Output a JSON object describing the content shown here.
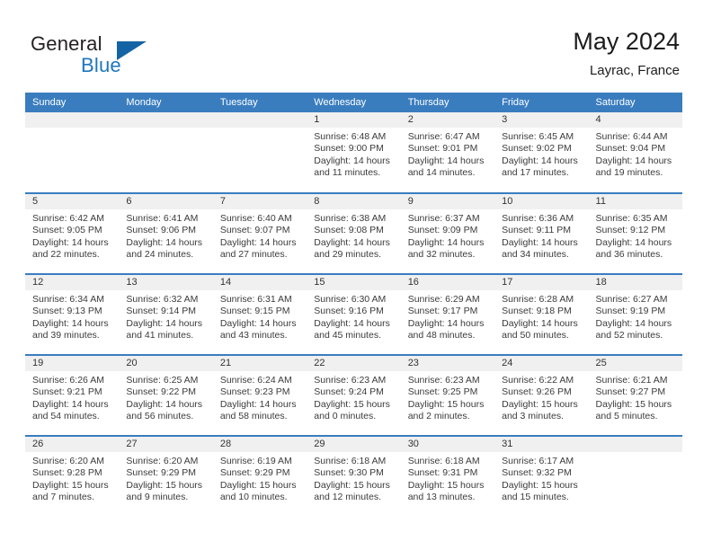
{
  "brand": {
    "name_part1": "General",
    "name_part2": "Blue"
  },
  "header": {
    "title": "May 2024",
    "subtitle": "Layrac, France"
  },
  "colors": {
    "header_blue": "#3a7dbf",
    "brand_blue": "#1e76bd",
    "daynum_band": "#f0f0f0",
    "text": "#3b3b3b"
  },
  "weekday_headers": [
    "Sunday",
    "Monday",
    "Tuesday",
    "Wednesday",
    "Thursday",
    "Friday",
    "Saturday"
  ],
  "labels": {
    "sunrise_prefix": "Sunrise:",
    "sunset_prefix": "Sunset:",
    "daylight_prefix": "Daylight:"
  },
  "weeks": [
    [
      {
        "day": "",
        "sunrise": "",
        "sunset": "",
        "daylight_line1": "",
        "daylight_line2": "",
        "empty": true
      },
      {
        "day": "",
        "sunrise": "",
        "sunset": "",
        "daylight_line1": "",
        "daylight_line2": "",
        "empty": true
      },
      {
        "day": "",
        "sunrise": "",
        "sunset": "",
        "daylight_line1": "",
        "daylight_line2": "",
        "empty": true
      },
      {
        "day": "1",
        "sunrise": "Sunrise: 6:48 AM",
        "sunset": "Sunset: 9:00 PM",
        "daylight_line1": "Daylight: 14 hours",
        "daylight_line2": "and 11 minutes.",
        "empty": false
      },
      {
        "day": "2",
        "sunrise": "Sunrise: 6:47 AM",
        "sunset": "Sunset: 9:01 PM",
        "daylight_line1": "Daylight: 14 hours",
        "daylight_line2": "and 14 minutes.",
        "empty": false
      },
      {
        "day": "3",
        "sunrise": "Sunrise: 6:45 AM",
        "sunset": "Sunset: 9:02 PM",
        "daylight_line1": "Daylight: 14 hours",
        "daylight_line2": "and 17 minutes.",
        "empty": false
      },
      {
        "day": "4",
        "sunrise": "Sunrise: 6:44 AM",
        "sunset": "Sunset: 9:04 PM",
        "daylight_line1": "Daylight: 14 hours",
        "daylight_line2": "and 19 minutes.",
        "empty": false
      }
    ],
    [
      {
        "day": "5",
        "sunrise": "Sunrise: 6:42 AM",
        "sunset": "Sunset: 9:05 PM",
        "daylight_line1": "Daylight: 14 hours",
        "daylight_line2": "and 22 minutes.",
        "empty": false
      },
      {
        "day": "6",
        "sunrise": "Sunrise: 6:41 AM",
        "sunset": "Sunset: 9:06 PM",
        "daylight_line1": "Daylight: 14 hours",
        "daylight_line2": "and 24 minutes.",
        "empty": false
      },
      {
        "day": "7",
        "sunrise": "Sunrise: 6:40 AM",
        "sunset": "Sunset: 9:07 PM",
        "daylight_line1": "Daylight: 14 hours",
        "daylight_line2": "and 27 minutes.",
        "empty": false
      },
      {
        "day": "8",
        "sunrise": "Sunrise: 6:38 AM",
        "sunset": "Sunset: 9:08 PM",
        "daylight_line1": "Daylight: 14 hours",
        "daylight_line2": "and 29 minutes.",
        "empty": false
      },
      {
        "day": "9",
        "sunrise": "Sunrise: 6:37 AM",
        "sunset": "Sunset: 9:09 PM",
        "daylight_line1": "Daylight: 14 hours",
        "daylight_line2": "and 32 minutes.",
        "empty": false
      },
      {
        "day": "10",
        "sunrise": "Sunrise: 6:36 AM",
        "sunset": "Sunset: 9:11 PM",
        "daylight_line1": "Daylight: 14 hours",
        "daylight_line2": "and 34 minutes.",
        "empty": false
      },
      {
        "day": "11",
        "sunrise": "Sunrise: 6:35 AM",
        "sunset": "Sunset: 9:12 PM",
        "daylight_line1": "Daylight: 14 hours",
        "daylight_line2": "and 36 minutes.",
        "empty": false
      }
    ],
    [
      {
        "day": "12",
        "sunrise": "Sunrise: 6:34 AM",
        "sunset": "Sunset: 9:13 PM",
        "daylight_line1": "Daylight: 14 hours",
        "daylight_line2": "and 39 minutes.",
        "empty": false
      },
      {
        "day": "13",
        "sunrise": "Sunrise: 6:32 AM",
        "sunset": "Sunset: 9:14 PM",
        "daylight_line1": "Daylight: 14 hours",
        "daylight_line2": "and 41 minutes.",
        "empty": false
      },
      {
        "day": "14",
        "sunrise": "Sunrise: 6:31 AM",
        "sunset": "Sunset: 9:15 PM",
        "daylight_line1": "Daylight: 14 hours",
        "daylight_line2": "and 43 minutes.",
        "empty": false
      },
      {
        "day": "15",
        "sunrise": "Sunrise: 6:30 AM",
        "sunset": "Sunset: 9:16 PM",
        "daylight_line1": "Daylight: 14 hours",
        "daylight_line2": "and 45 minutes.",
        "empty": false
      },
      {
        "day": "16",
        "sunrise": "Sunrise: 6:29 AM",
        "sunset": "Sunset: 9:17 PM",
        "daylight_line1": "Daylight: 14 hours",
        "daylight_line2": "and 48 minutes.",
        "empty": false
      },
      {
        "day": "17",
        "sunrise": "Sunrise: 6:28 AM",
        "sunset": "Sunset: 9:18 PM",
        "daylight_line1": "Daylight: 14 hours",
        "daylight_line2": "and 50 minutes.",
        "empty": false
      },
      {
        "day": "18",
        "sunrise": "Sunrise: 6:27 AM",
        "sunset": "Sunset: 9:19 PM",
        "daylight_line1": "Daylight: 14 hours",
        "daylight_line2": "and 52 minutes.",
        "empty": false
      }
    ],
    [
      {
        "day": "19",
        "sunrise": "Sunrise: 6:26 AM",
        "sunset": "Sunset: 9:21 PM",
        "daylight_line1": "Daylight: 14 hours",
        "daylight_line2": "and 54 minutes.",
        "empty": false
      },
      {
        "day": "20",
        "sunrise": "Sunrise: 6:25 AM",
        "sunset": "Sunset: 9:22 PM",
        "daylight_line1": "Daylight: 14 hours",
        "daylight_line2": "and 56 minutes.",
        "empty": false
      },
      {
        "day": "21",
        "sunrise": "Sunrise: 6:24 AM",
        "sunset": "Sunset: 9:23 PM",
        "daylight_line1": "Daylight: 14 hours",
        "daylight_line2": "and 58 minutes.",
        "empty": false
      },
      {
        "day": "22",
        "sunrise": "Sunrise: 6:23 AM",
        "sunset": "Sunset: 9:24 PM",
        "daylight_line1": "Daylight: 15 hours",
        "daylight_line2": "and 0 minutes.",
        "empty": false
      },
      {
        "day": "23",
        "sunrise": "Sunrise: 6:23 AM",
        "sunset": "Sunset: 9:25 PM",
        "daylight_line1": "Daylight: 15 hours",
        "daylight_line2": "and 2 minutes.",
        "empty": false
      },
      {
        "day": "24",
        "sunrise": "Sunrise: 6:22 AM",
        "sunset": "Sunset: 9:26 PM",
        "daylight_line1": "Daylight: 15 hours",
        "daylight_line2": "and 3 minutes.",
        "empty": false
      },
      {
        "day": "25",
        "sunrise": "Sunrise: 6:21 AM",
        "sunset": "Sunset: 9:27 PM",
        "daylight_line1": "Daylight: 15 hours",
        "daylight_line2": "and 5 minutes.",
        "empty": false
      }
    ],
    [
      {
        "day": "26",
        "sunrise": "Sunrise: 6:20 AM",
        "sunset": "Sunset: 9:28 PM",
        "daylight_line1": "Daylight: 15 hours",
        "daylight_line2": "and 7 minutes.",
        "empty": false
      },
      {
        "day": "27",
        "sunrise": "Sunrise: 6:20 AM",
        "sunset": "Sunset: 9:29 PM",
        "daylight_line1": "Daylight: 15 hours",
        "daylight_line2": "and 9 minutes.",
        "empty": false
      },
      {
        "day": "28",
        "sunrise": "Sunrise: 6:19 AM",
        "sunset": "Sunset: 9:29 PM",
        "daylight_line1": "Daylight: 15 hours",
        "daylight_line2": "and 10 minutes.",
        "empty": false
      },
      {
        "day": "29",
        "sunrise": "Sunrise: 6:18 AM",
        "sunset": "Sunset: 9:30 PM",
        "daylight_line1": "Daylight: 15 hours",
        "daylight_line2": "and 12 minutes.",
        "empty": false
      },
      {
        "day": "30",
        "sunrise": "Sunrise: 6:18 AM",
        "sunset": "Sunset: 9:31 PM",
        "daylight_line1": "Daylight: 15 hours",
        "daylight_line2": "and 13 minutes.",
        "empty": false
      },
      {
        "day": "31",
        "sunrise": "Sunrise: 6:17 AM",
        "sunset": "Sunset: 9:32 PM",
        "daylight_line1": "Daylight: 15 hours",
        "daylight_line2": "and 15 minutes.",
        "empty": false
      },
      {
        "day": "",
        "sunrise": "",
        "sunset": "",
        "daylight_line1": "",
        "daylight_line2": "",
        "empty": true
      }
    ]
  ]
}
